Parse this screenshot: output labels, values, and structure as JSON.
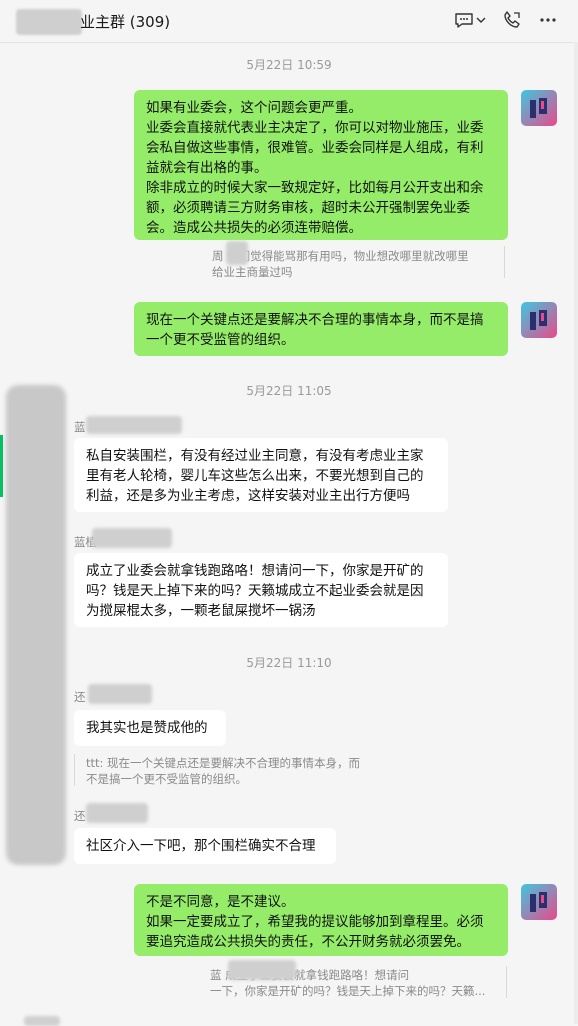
{
  "header": {
    "title": "业主群 (309)",
    "icons": [
      "chat-bubble-icon",
      "chevron-down-icon",
      "phone-icon",
      "more-icon"
    ]
  },
  "timestamps": [
    "5月22日 10:59",
    "5月22日 11:05",
    "5月22日 11:10"
  ],
  "messages": {
    "m1": {
      "lines": [
        "如果有业委会，这个问题会更严重。",
        "业委会直接就代表业主决定了，你可以对物业施压，业委",
        "会私自做这些事情，很难管。业委会同样是人组成，有利",
        "益就会有出格的事。",
        "除非成立的时候大家一致规定好，比如每月公开支出和余",
        "额，必须聘请三方财务审核，超时未公开强制罢免业委",
        "会。造成公共损失的必须连带赔偿。"
      ]
    },
    "q1": {
      "lines": [
        "周      你们觉得能骂那有用吗，物业想改哪里就改哪里",
        "给业主商量过吗"
      ]
    },
    "m2": {
      "lines": [
        "现在一个关键点还是要解决不合理的事情本身，而不是搞",
        "一个更不受监管的组织。"
      ]
    },
    "m3": {
      "sender": "蓝",
      "lines": [
        "私自安装围栏，有没有经过业主同意，有没有考虑业主家",
        "里有老人轮椅，婴儿车这些怎么出来，不要光想到自己的",
        "利益，还是多为业主考虑，这样安装对业主出行方便吗"
      ]
    },
    "m4": {
      "sender": "蓝植",
      "lines": [
        "成立了业委会就拿钱跑路咯！想请问一下，你家是开矿的",
        "吗？钱是天上掉下来的吗？天籁城成立不起业委会就是因",
        "为搅屎棍太多，一颗老鼠屎搅坏一锅汤"
      ]
    },
    "m5": {
      "sender": "还",
      "text": "我其实也是赞成他的"
    },
    "q2": {
      "lines": [
        "ttt: 现在一个关键点还是要解决不合理的事情本身，而",
        "不是搞一个更不受监管的组织。"
      ]
    },
    "m6": {
      "sender": "还",
      "text": "社区介入一下吧，那个围栏确实不合理"
    },
    "m7": {
      "lines": [
        "不是不同意，是不建议。",
        "如果一定要成立了，希望我的提议能够加到章程里。必须",
        "要追究造成公共损失的责任，不公开财务就必须罢免。"
      ]
    },
    "q3": {
      "lines": [
        "蓝              成立了业委会就拿钱跑路咯！想请问",
        "一下，你家是开矿的吗？钱是天上掉下来的吗？天籁..."
      ]
    }
  },
  "colors": {
    "bubble_mine": "#95ec69",
    "bubble_other": "#ffffff",
    "background": "#f5f5f5"
  }
}
